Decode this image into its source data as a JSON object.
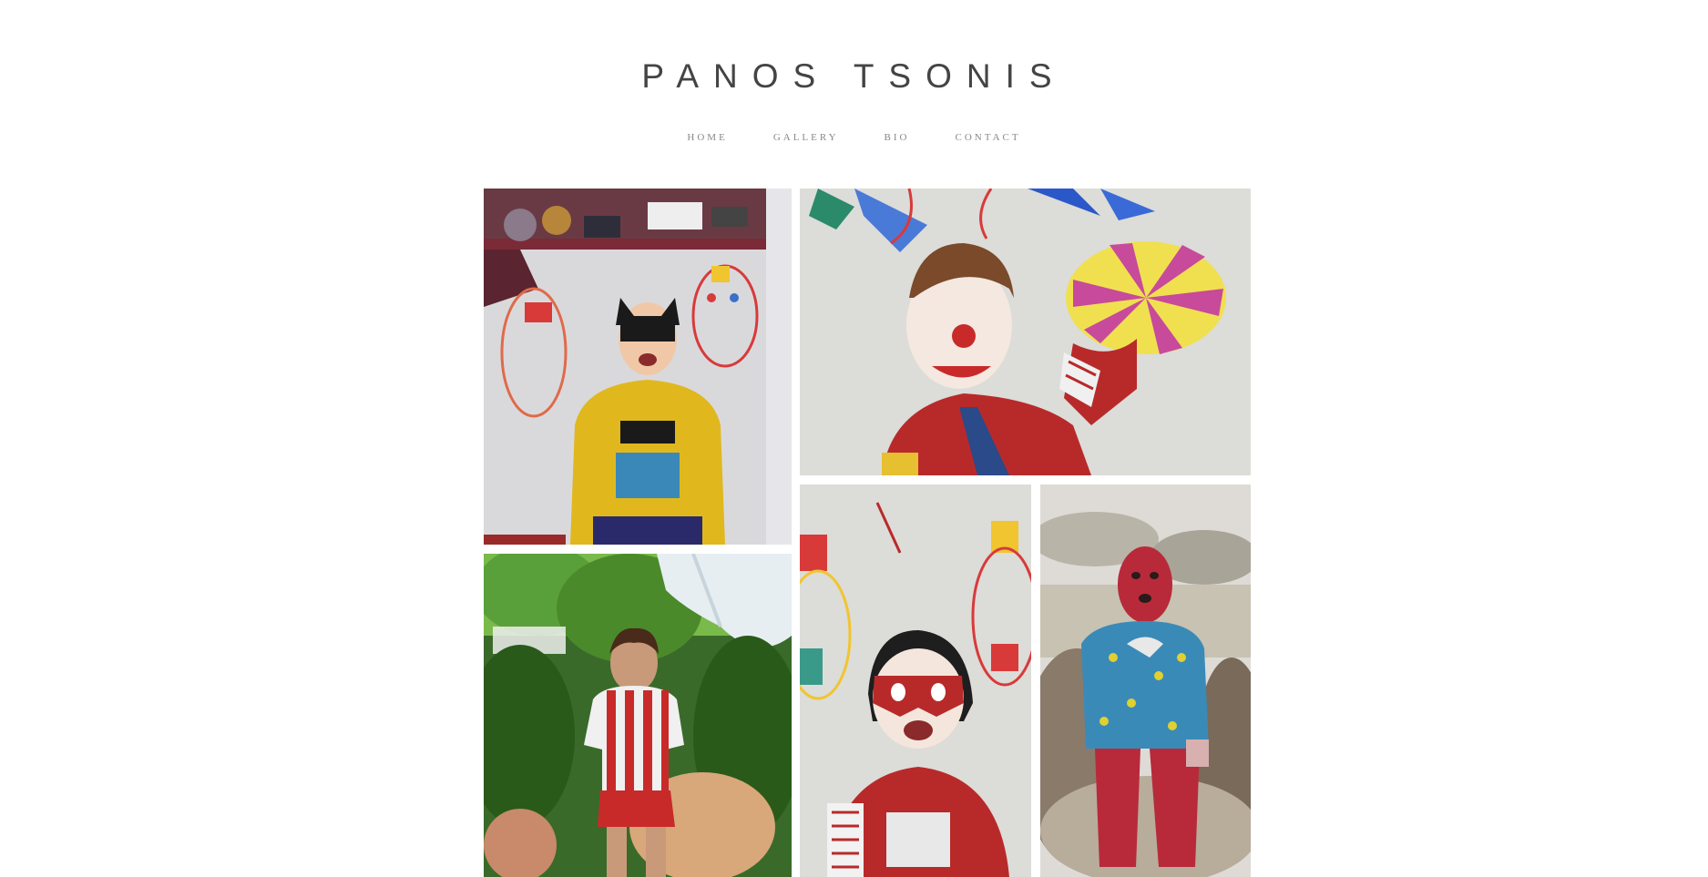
{
  "site": {
    "title": "PANOS TSONIS"
  },
  "nav": {
    "items": [
      {
        "label": "HOME"
      },
      {
        "label": "GALLERY"
      },
      {
        "label": "BIO"
      },
      {
        "label": "CONTACT"
      }
    ]
  },
  "gallery": {
    "tiles": [
      {
        "subject": "child-batman-mask-painting"
      },
      {
        "subject": "child-clown-with-hat-painting"
      },
      {
        "subject": "child-red-white-striped-shirt-garden-painting"
      },
      {
        "subject": "child-red-mask-drawings-painting"
      },
      {
        "subject": "child-red-balaclava-painting"
      }
    ]
  }
}
